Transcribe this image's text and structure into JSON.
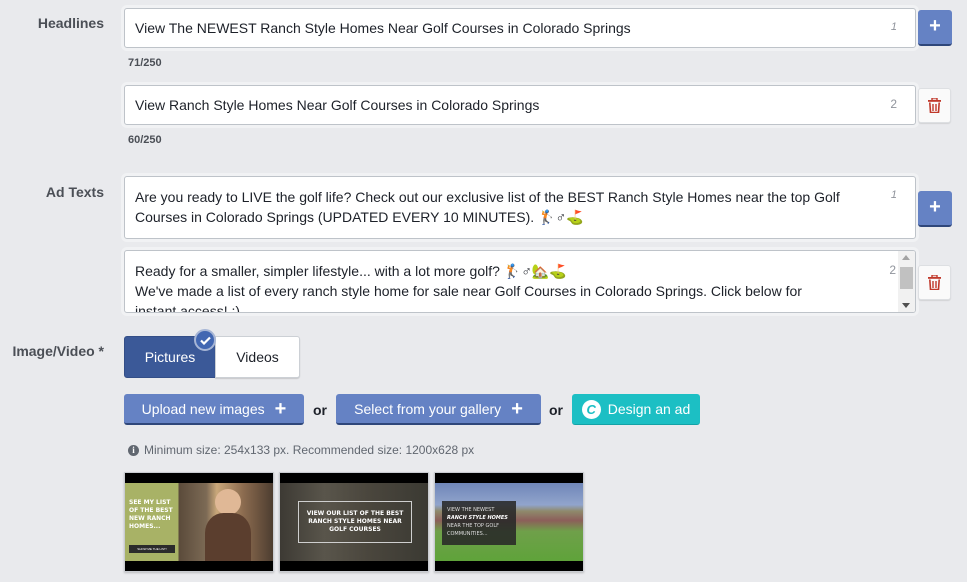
{
  "headlines": {
    "label": "Headlines",
    "items": [
      {
        "value": "View The NEWEST Ranch Style Homes Near Golf Courses in Colorado Springs",
        "index": "1",
        "counter": "71/250",
        "action": "add"
      },
      {
        "value": "View Ranch Style Homes Near Golf Courses in Colorado Springs",
        "index": "2",
        "counter": "60/250",
        "action": "delete"
      }
    ]
  },
  "ad_texts": {
    "label": "Ad Texts",
    "items": [
      {
        "lines": [
          "Are you ready to LIVE the golf life? Check out our exclusive list of the BEST Ranch Style Homes near the top Golf",
          "Courses in Colorado Springs (UPDATED EVERY 10 MINUTES). 🏌♂⛳"
        ],
        "index": "1",
        "action": "add"
      },
      {
        "lines": [
          "Ready for a smaller, simpler lifestyle... with a lot more golf? 🏌♂🏡⛳",
          "We've made a list of every ranch style home for sale near Golf Courses in Colorado Springs. Click below for",
          "instant access! :)"
        ],
        "index": "2",
        "action": "delete"
      }
    ]
  },
  "media": {
    "label": "Image/Video *",
    "tabs": [
      {
        "label": "Pictures",
        "selected": true
      },
      {
        "label": "Videos",
        "selected": false
      }
    ],
    "upload_label": "Upload new images",
    "gallery_label": "Select from your gallery",
    "design_label": "Design an ad",
    "or_text": "or",
    "hint": "Minimum size: 254x133 px. Recommended size: 1200x628 px",
    "thumbnails": [
      {
        "caption": "SEE MY LIST OF THE BEST NEW RANCH HOMES...",
        "button": "SHOW ME THE LIST!"
      },
      {
        "caption": "VIEW OUR LIST OF THE BEST RANCH STYLE HOMES NEAR GOLF COURSES"
      },
      {
        "caption_lines": [
          "VIEW THE NEWEST",
          "RANCH STYLE HOMES",
          "NEAR THE TOP GOLF",
          "COMMUNITIES..."
        ]
      }
    ]
  },
  "colors": {
    "primary": "#6582c4",
    "selected_tab": "#3b5998",
    "design_button": "#1cbfc4",
    "delete_icon": "#c0392b",
    "background": "#e9eaed"
  }
}
